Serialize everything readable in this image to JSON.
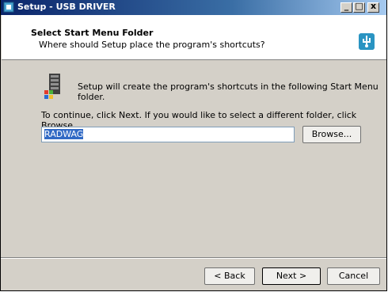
{
  "window": {
    "title": "Setup - USB DRIVER",
    "controls": {
      "minimize": "_",
      "maximize": "□",
      "close": "x"
    }
  },
  "header": {
    "title": "Select Start Menu Folder",
    "subtitle": "Where should Setup place the program's shortcuts?"
  },
  "body": {
    "info_text": "Setup will create the program's shortcuts in the following Start Menu folder.",
    "continue_text": "To continue, click Next. If you would like to select a different folder, click Browse.",
    "folder_value": "RADWAG",
    "browse_label": "Browse..."
  },
  "footer": {
    "back_label": "< Back",
    "next_label": "Next >",
    "cancel_label": "Cancel"
  },
  "colors": {
    "titlebar_start": "#0a246a",
    "titlebar_end": "#a6caf0",
    "dialog_bg": "#d4d0c8",
    "selection": "#316ac5"
  },
  "icons": {
    "title": "setup-app-icon",
    "header": "usb-installer-icon",
    "folder": "start-menu-folder-icon"
  }
}
